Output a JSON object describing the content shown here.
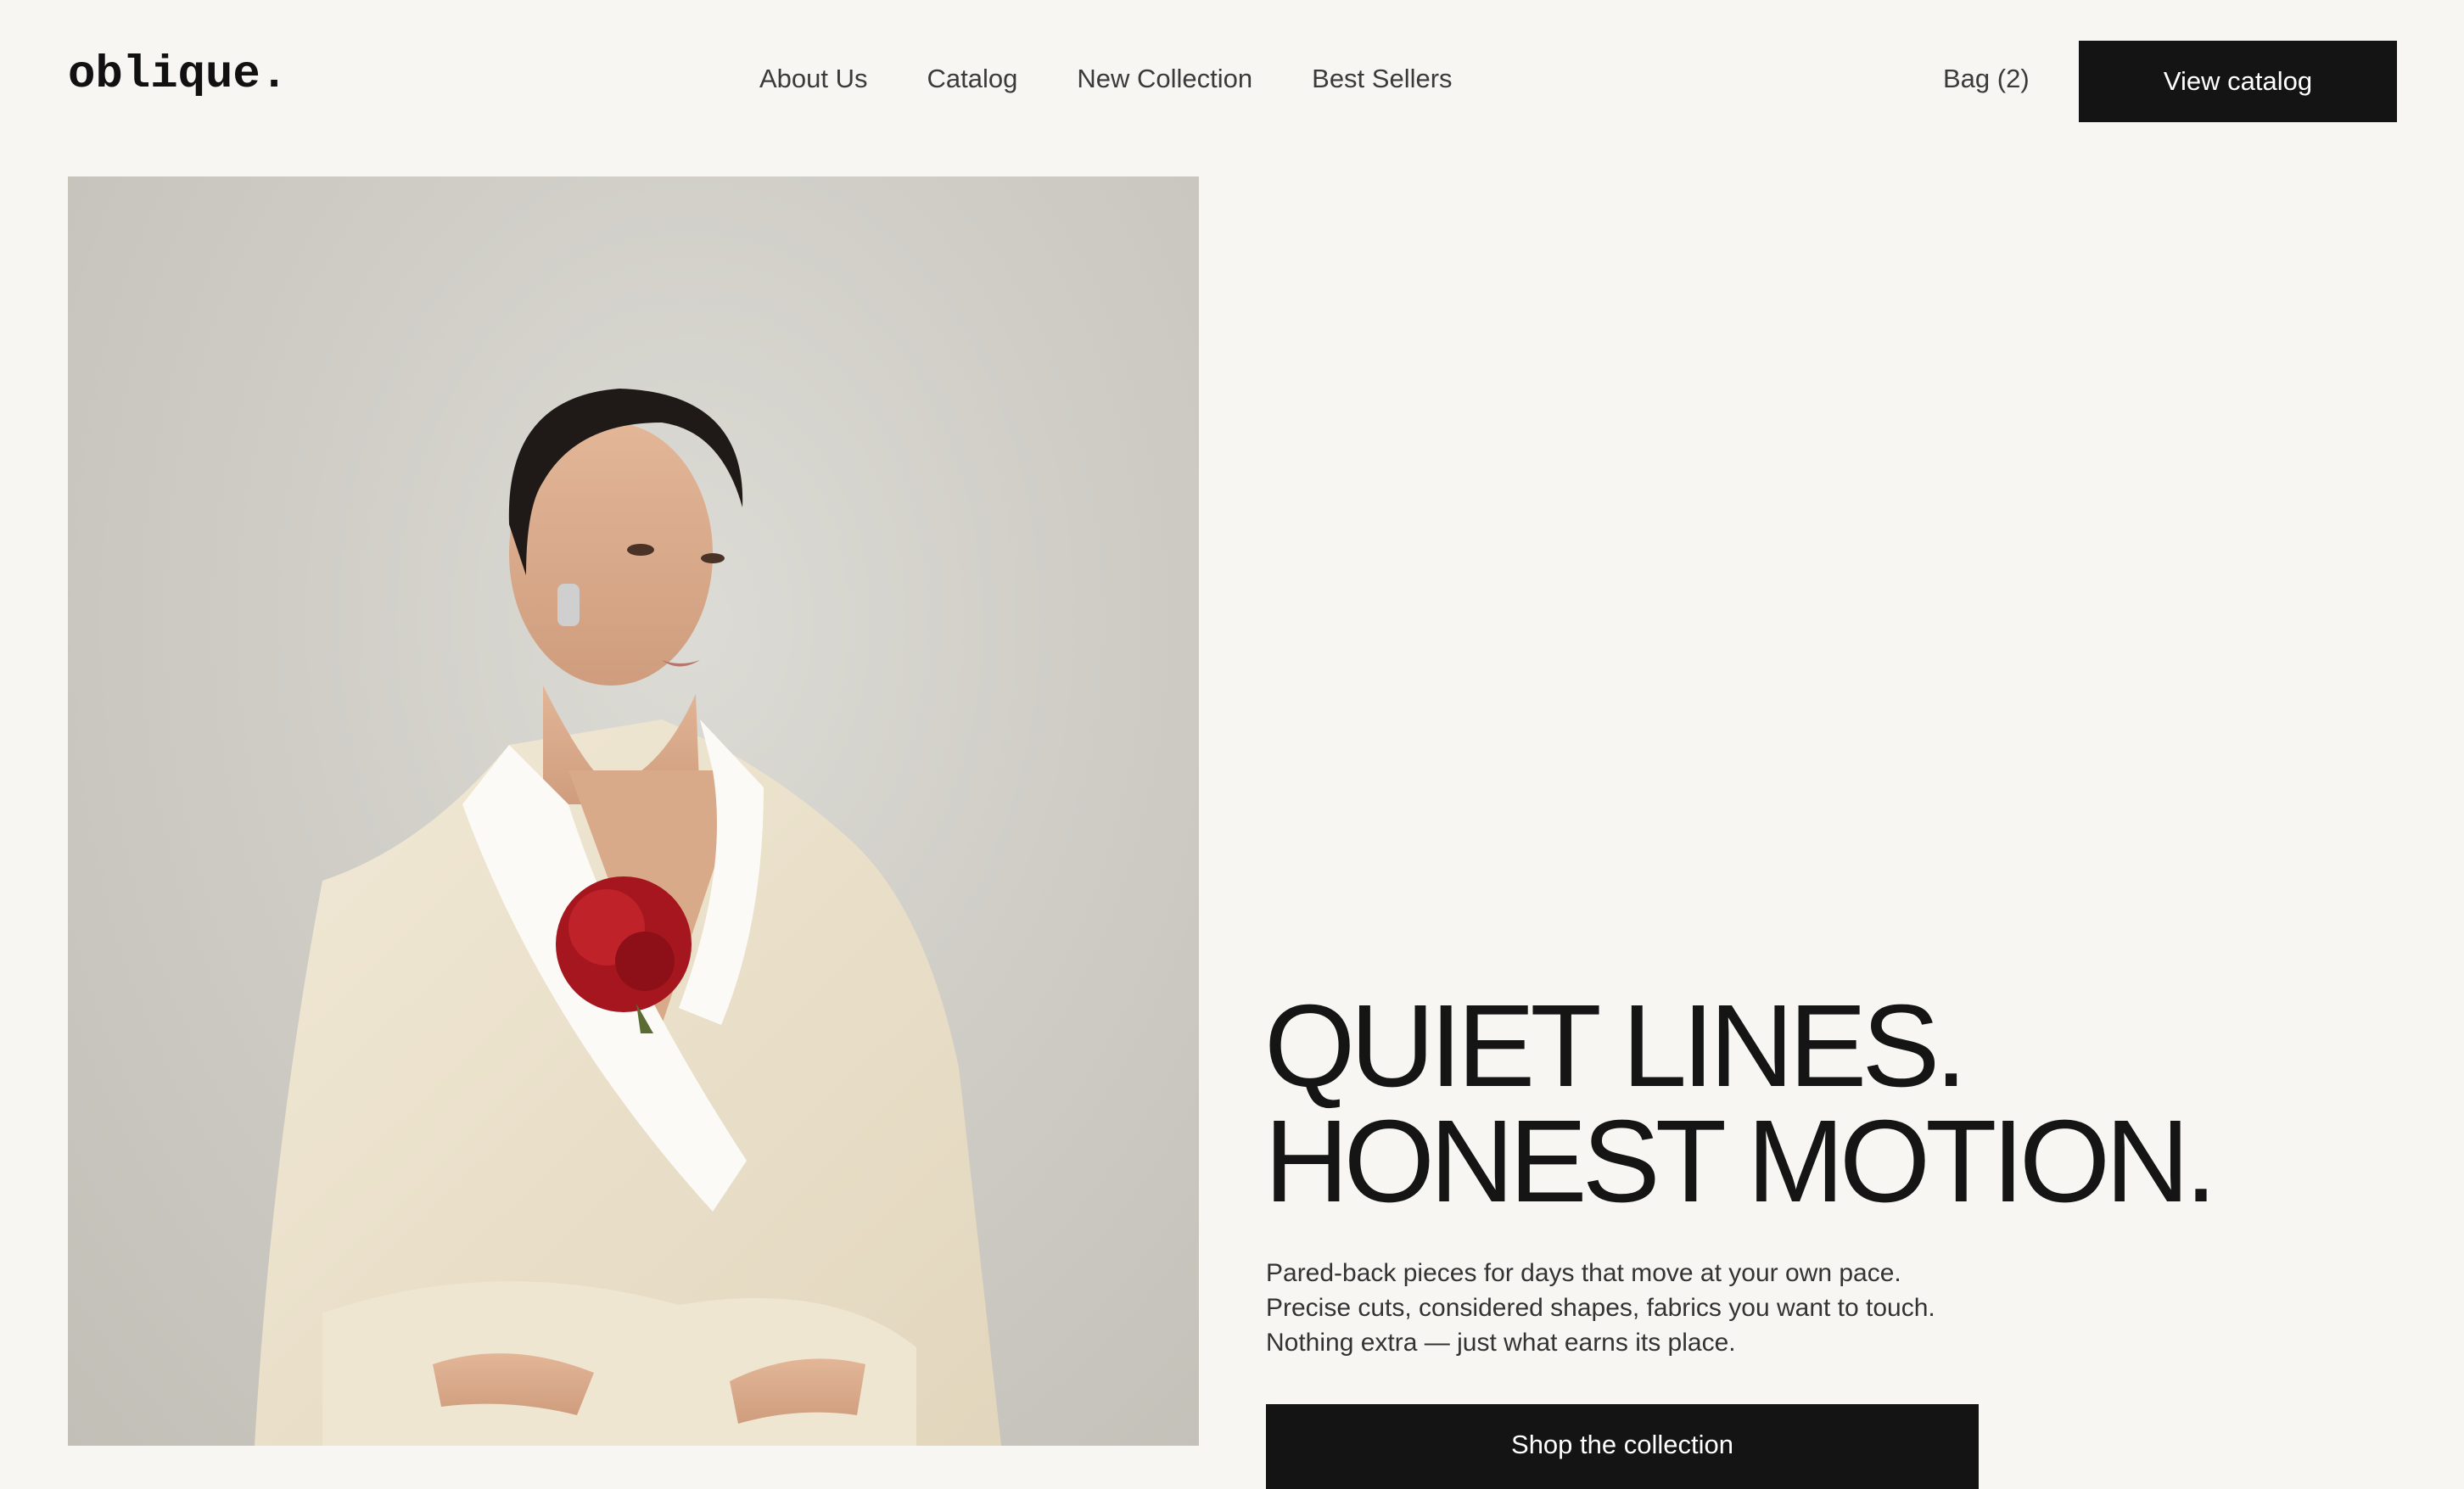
{
  "brand": {
    "logo": "oblique."
  },
  "nav": {
    "items": [
      {
        "label": "About Us"
      },
      {
        "label": "Catalog"
      },
      {
        "label": "New Collection"
      },
      {
        "label": "Best Sellers"
      }
    ]
  },
  "header": {
    "bag_label": "Bag (2)",
    "cta_label": "View catalog"
  },
  "hero": {
    "headline_line1": "QUIET LINES.",
    "headline_line2": "HONEST MOTION.",
    "description": "Pared-back pieces for days that move at your own pace. Precise cuts, considered shapes, fabrics you want to touch. Nothing extra — just what earns its place.",
    "cta_label": "Shop the collection"
  },
  "colors": {
    "background": "#f8f6f3",
    "button": "#141414",
    "button_text": "#ffffff"
  }
}
